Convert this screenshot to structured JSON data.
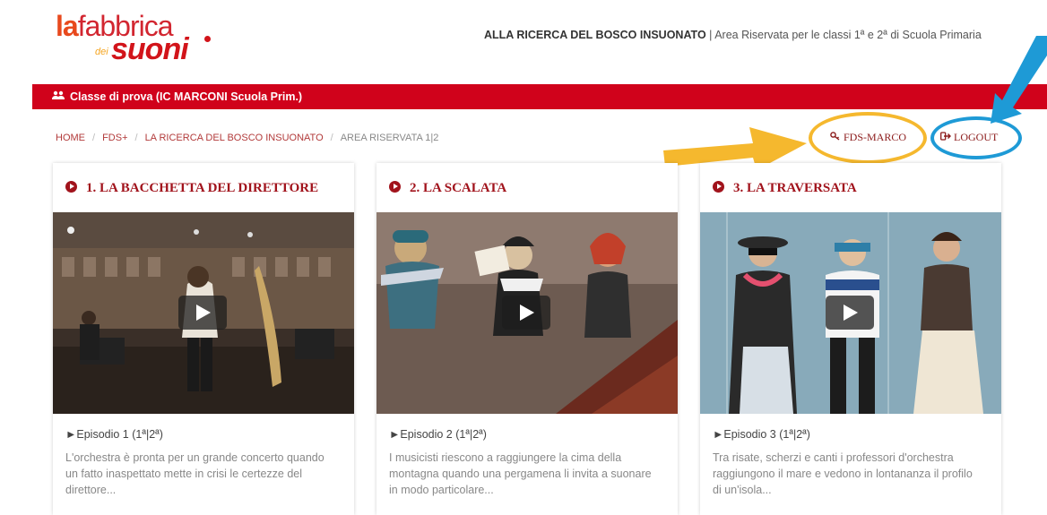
{
  "logo": {
    "part1": "la",
    "part2": "fabbrica",
    "dei": "dei",
    "suoni": "suoni"
  },
  "header": {
    "title_bold": "ALLA RICERCA DEL BOSCO INSUONATO",
    "subtitle": " | Area Riservata per le classi 1ª e 2ª di Scuola Primaria"
  },
  "class_bar": {
    "label": "Classe di prova (IC MARCONI Scuola Prim.)"
  },
  "breadcrumb": {
    "items": [
      "HOME",
      "FDS+",
      "LA RICERCA DEL BOSCO INSUONATO",
      "AREA RISERVATA 1|2"
    ],
    "sep": "/"
  },
  "user": {
    "name": "FDS-MARCO"
  },
  "logout": {
    "label": "LOGOUT"
  },
  "cards": [
    {
      "title": "1. LA BACCHETTA DEL DIRETTORE",
      "episode": "►Episodio 1 (1ª|2ª)",
      "desc": "L'orchestra è pronta per un grande concerto quando un fatto inaspettato mette in crisi le certezze del direttore..."
    },
    {
      "title": "2. LA SCALATA",
      "episode": "►Episodio 2 (1ª|2ª)",
      "desc": "I musicisti riescono a raggiungere la cima della montagna quando una pergamena li invita a suonare in modo particolare..."
    },
    {
      "title": "3. LA TRAVERSATA",
      "episode": "►Episodio 3 (1ª|2ª)",
      "desc": "Tra risate, scherzi e canti i professori d'orchestra raggiungono il mare e vedono in lontananza il profilo di un'isola..."
    }
  ],
  "colors": {
    "brand_red": "#d0021b",
    "title_red": "#a1131c",
    "highlight_yellow": "#f5b82e",
    "highlight_blue": "#1e9ad6"
  }
}
